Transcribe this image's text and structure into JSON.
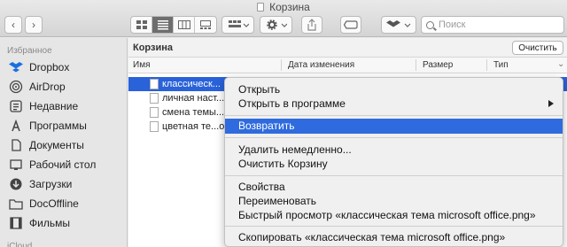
{
  "window": {
    "title": "Корзина"
  },
  "toolbar": {
    "search_placeholder": "Поиск"
  },
  "sidebar": {
    "favorites_header": "Избранное",
    "items": [
      {
        "label": "Dropbox",
        "icon": "dropbox-icon"
      },
      {
        "label": "AirDrop",
        "icon": "airdrop-icon"
      },
      {
        "label": "Недавние",
        "icon": "recents-icon"
      },
      {
        "label": "Программы",
        "icon": "applications-icon"
      },
      {
        "label": "Документы",
        "icon": "documents-icon"
      },
      {
        "label": "Рабочий стол",
        "icon": "desktop-icon"
      },
      {
        "label": "Загрузки",
        "icon": "downloads-icon"
      },
      {
        "label": "DocOffline",
        "icon": "folder-icon"
      },
      {
        "label": "Фильмы",
        "icon": "movies-icon"
      }
    ],
    "icloud_header": "iCloud"
  },
  "main": {
    "path_title": "Корзина",
    "empty_button": "Очистить",
    "columns": {
      "name": "Имя",
      "date": "Дата изменения",
      "size": "Размер",
      "kind": "Тип"
    },
    "files": [
      {
        "name": "классическ...",
        "selected": true
      },
      {
        "name": "личная наст..."
      },
      {
        "name": "смена темы..."
      },
      {
        "name": "цветная те...от"
      }
    ]
  },
  "context_menu": {
    "items": [
      {
        "label": "Открыть"
      },
      {
        "label": "Открыть в программе",
        "submenu": true
      },
      {
        "label": "Возвратить",
        "highlighted": true
      },
      {
        "label": "Удалить немедленно..."
      },
      {
        "label": "Очистить Корзину"
      },
      {
        "label": "Свойства"
      },
      {
        "label": "Переименовать"
      },
      {
        "label": "Быстрый просмотр «классическая тема microsoft office.png»"
      },
      {
        "label": "Скопировать «классическая тема microsoft office.png»"
      }
    ]
  },
  "colors": {
    "selection": "#2962d9",
    "menu_highlight": "#2f6bde",
    "dropbox": "#0061fe"
  }
}
